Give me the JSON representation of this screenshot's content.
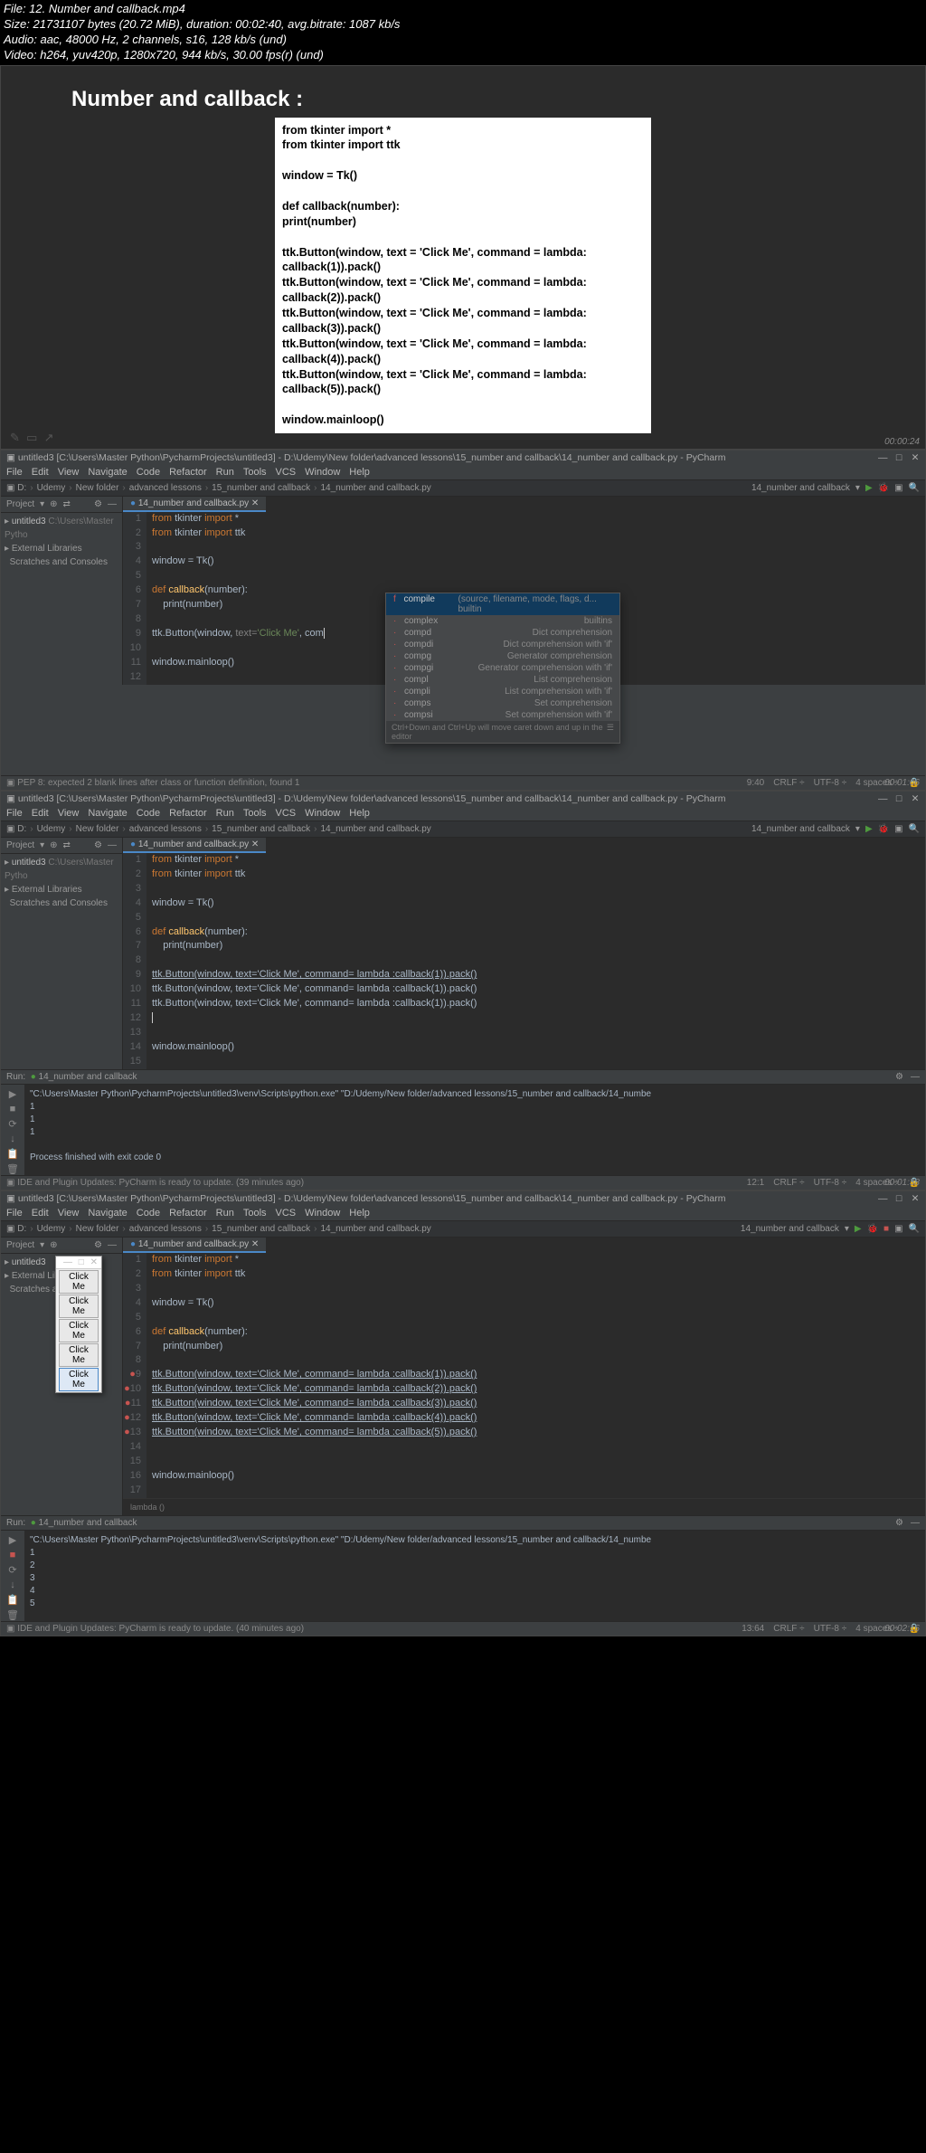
{
  "meta": {
    "l1": "File: 12. Number and callback.mp4",
    "l2": "Size: 21731107 bytes (20.72 MiB), duration: 00:02:40, avg.bitrate: 1087 kb/s",
    "l3": "Audio: aac, 48000 Hz, 2 channels, s16, 128 kb/s (und)",
    "l4": "Video: h264, yuv420p, 1280x720, 944 kb/s, 30.00 fps(r) (und)"
  },
  "slide": {
    "title": "Number and callback :",
    "code": [
      "from tkinter import *",
      "from tkinter import ttk",
      "",
      "window = Tk()",
      "",
      "def callback(number):",
      "    print(number)",
      "",
      "ttk.Button(window, text = 'Click Me', command = lambda: callback(1)).pack()",
      "ttk.Button(window, text = 'Click Me', command = lambda: callback(2)).pack()",
      "ttk.Button(window, text = 'Click Me', command = lambda: callback(3)).pack()",
      "ttk.Button(window, text = 'Click Me', command = lambda: callback(4)).pack()",
      "ttk.Button(window, text = 'Click Me', command = lambda: callback(5)).pack()",
      "",
      "window.mainloop()"
    ]
  },
  "timestamps": {
    "f1": "00:00:24",
    "f2": "00:01:06",
    "f3": "00:01:38",
    "f4": "00:02:16"
  },
  "ide": {
    "title": "untitled3 [C:\\Users\\Master Python\\PycharmProjects\\untitled3] - D:\\Udemy\\New folder\\advanced lessons\\15_number and callback\\14_number and callback.py - PyCharm",
    "menus": [
      "File",
      "Edit",
      "View",
      "Navigate",
      "Code",
      "Refactor",
      "Run",
      "Tools",
      "VCS",
      "Window",
      "Help"
    ],
    "breadcrumb": [
      "D:",
      "Udemy",
      "New folder",
      "advanced lessons",
      "15_number and callback",
      "14_number and callback.py"
    ],
    "runconfig": "14_number and callback",
    "project": {
      "head": "Project",
      "root": "untitled3",
      "rootpath": "C:\\Users\\Master Pytho",
      "libs": "External Libraries",
      "scratch": "Scratches and Consoles"
    },
    "tab": "14_number and callback.py"
  },
  "frame2": {
    "gutter": [
      "1",
      "2",
      "3",
      "4",
      "5",
      "6",
      "7",
      "8",
      "9",
      "10",
      "11",
      "12"
    ],
    "code_lines": {
      "l1_a": "from ",
      "l1_b": "tkinter ",
      "l1_c": "import ",
      "l1_d": "*",
      "l2_a": "from ",
      "l2_b": "tkinter ",
      "l2_c": "import ",
      "l2_d": "ttk",
      "l4": "window = Tk()",
      "l6_a": "def ",
      "l6_b": "callback",
      "l6_c": "(number):",
      "l7": "    print(number)",
      "l9_a": "ttk.Button(window, ",
      "l9_b": "text=",
      "l9_c": "'Click Me'",
      "l9_d": ", com",
      "l11": "window.mainloop()"
    },
    "autocomplete": [
      {
        "icon": "f",
        "name": "compile",
        "desc": "(source, filename, mode, flags, d...  builtin"
      },
      {
        "icon": "",
        "name": "complex",
        "desc": "builtins"
      },
      {
        "icon": "",
        "name": "compd",
        "desc": "Dict comprehension"
      },
      {
        "icon": "",
        "name": "compdi",
        "desc": "Dict comprehension with 'if'"
      },
      {
        "icon": "",
        "name": "compg",
        "desc": "Generator comprehension"
      },
      {
        "icon": "",
        "name": "compgi",
        "desc": "Generator comprehension with 'if'"
      },
      {
        "icon": "",
        "name": "compl",
        "desc": "List comprehension"
      },
      {
        "icon": "",
        "name": "compli",
        "desc": "List comprehension with 'if'"
      },
      {
        "icon": "",
        "name": "comps",
        "desc": "Set comprehension"
      },
      {
        "icon": "",
        "name": "compsi",
        "desc": "Set comprehension with 'if'"
      }
    ],
    "ac_hint_l": "Ctrl+Down and Ctrl+Up will move caret down and up in the editor",
    "ac_hint_r": "☰",
    "status_l": "PEP 8: expected 2 blank lines after class or function definition, found 1",
    "status_r": [
      "9:40",
      "CRLF ÷",
      "UTF-8 ÷",
      "4 spaces ÷",
      "🔒"
    ]
  },
  "frame3": {
    "gutter": [
      "1",
      "2",
      "3",
      "4",
      "5",
      "6",
      "7",
      "8",
      "9",
      "10",
      "11",
      "12",
      "13",
      "14",
      "15"
    ],
    "code_l9": "ttk.Button(window, text='Click Me', command= lambda :callback(1)).pack()",
    "code_l10": "ttk.Button(window, text='Click Me', command= lambda :callback(1)).pack()",
    "code_l11": "ttk.Button(window, text='Click Me', command= lambda :callback(1)).pack()",
    "code_l14": "window.mainloop()",
    "run": {
      "head": "14_number and callback",
      "line1": "\"C:\\Users\\Master Python\\PycharmProjects\\untitled3\\venv\\Scripts\\python.exe\" \"D:/Udemy/New folder/advanced lessons/15_number and callback/14_numbe",
      "out": [
        "1",
        "1",
        "1"
      ],
      "exit": "Process finished with exit code 0"
    },
    "status_l": "IDE and Plugin Updates: PyCharm is ready to update. (39 minutes ago)",
    "status_r": [
      "12:1",
      "CRLF ÷",
      "UTF-8 ÷",
      "4 spaces ÷",
      "🔒"
    ]
  },
  "frame4": {
    "gutter": [
      "1",
      "2",
      "3",
      "4",
      "5",
      "6",
      "7",
      "8",
      "9",
      "10",
      "11",
      "12",
      "13",
      "14",
      "15",
      "16",
      "17"
    ],
    "code_l9": "ttk.Button(window, text='Click Me', command= lambda :callback(1)).pack()",
    "code_l10": "ttk.Button(window, text='Click Me', command= lambda :callback(2)).pack()",
    "code_l11": "ttk.Button(window, text='Click Me', command= lambda :callback(3)).pack()",
    "code_l12": "ttk.Button(window, text='Click Me', command= lambda :callback(4)).pack()",
    "code_l13": "ttk.Button(window, text='Click Me', command= lambda :callback(5)).pack()",
    "code_l16": "window.mainloop()",
    "lambda_crumb": "lambda ()",
    "tkwin": {
      "btns": [
        "Click Me",
        "Click Me",
        "Click Me",
        "Click Me",
        "Click Me"
      ]
    },
    "run": {
      "head": "14_number and callback",
      "line1": "\"C:\\Users\\Master Python\\PycharmProjects\\untitled3\\venv\\Scripts\\python.exe\" \"D:/Udemy/New folder/advanced lessons/15_number and callback/14_numbe",
      "out": [
        "1",
        "2",
        "3",
        "4",
        "5"
      ]
    },
    "status_l": "IDE and Plugin Updates: PyCharm is ready to update. (40 minutes ago)",
    "status_r": [
      "13:64",
      "CRLF ÷",
      "UTF-8 ÷",
      "4 spaces ÷",
      "🔒"
    ]
  }
}
